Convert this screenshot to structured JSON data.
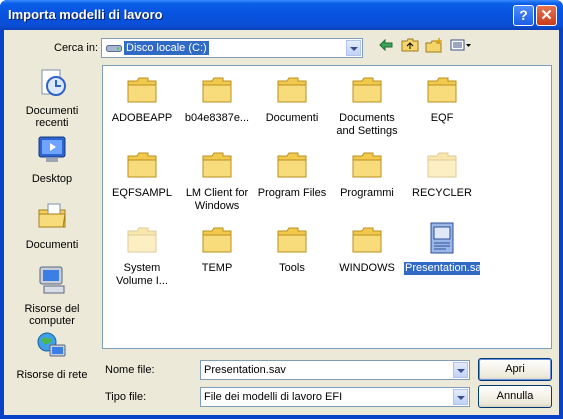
{
  "window": {
    "title": "Importa modelli di lavoro",
    "help_glyph": "?",
    "close_glyph": "✕"
  },
  "lookin": {
    "label": "Cerca in:",
    "value": "Disco locale (C:)"
  },
  "toolbar": {
    "icons": [
      "back-arrow-icon",
      "up-folder-icon",
      "new-folder-icon",
      "view-menu-icon"
    ]
  },
  "places": [
    {
      "label": "Documenti recenti",
      "icon": "recent-documents-icon"
    },
    {
      "label": "Desktop",
      "icon": "desktop-icon"
    },
    {
      "label": "Documenti",
      "icon": "my-documents-icon"
    },
    {
      "label": "Risorse del computer",
      "icon": "my-computer-icon"
    },
    {
      "label": "Risorse di rete",
      "icon": "network-places-icon"
    }
  ],
  "files": [
    {
      "name": "ADOBEAPP",
      "type": "folder"
    },
    {
      "name": "b04e8387e...",
      "type": "folder"
    },
    {
      "name": "Documenti",
      "type": "folder"
    },
    {
      "name": "Documents and Settings",
      "type": "folder"
    },
    {
      "name": "EQF",
      "type": "folder"
    },
    {
      "name": "EQFSAMPL",
      "type": "folder"
    },
    {
      "name": "LM Client for Windows",
      "type": "folder"
    },
    {
      "name": "Program Files",
      "type": "folder"
    },
    {
      "name": "Programmi",
      "type": "folder"
    },
    {
      "name": "RECYCLER",
      "type": "folder-hidden"
    },
    {
      "name": "System Volume I...",
      "type": "folder-hidden"
    },
    {
      "name": "TEMP",
      "type": "folder"
    },
    {
      "name": "Tools",
      "type": "folder"
    },
    {
      "name": "WINDOWS",
      "type": "folder"
    },
    {
      "name": "Presentation.sav",
      "type": "file",
      "selected": true
    }
  ],
  "filename": {
    "label": "Nome file:",
    "value": "Presentation.sav"
  },
  "filetype": {
    "label": "Tipo file:",
    "value": "File dei modelli di lavoro EFI"
  },
  "buttons": {
    "open": "Apri",
    "cancel": "Annulla"
  },
  "colors": {
    "selection": "#316ac5",
    "titlebar": "#0753e0",
    "face": "#ece9d8"
  }
}
